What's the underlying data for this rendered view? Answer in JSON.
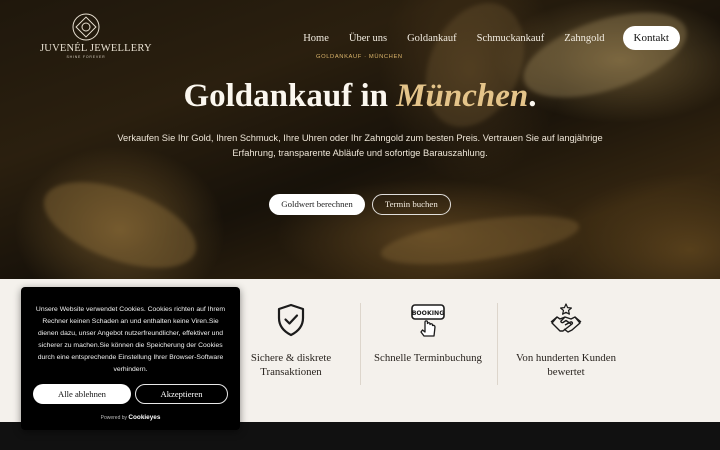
{
  "brand": {
    "name": "JUVENÉL JEWELLERY",
    "tagline": "SHINE FOREVER"
  },
  "nav": {
    "items": [
      "Home",
      "Über uns",
      "Goldankauf",
      "Schmuckankauf",
      "Zahngold"
    ],
    "contact": "Kontakt"
  },
  "hero": {
    "breadcrumb": "GOLDANKAUF · MÜNCHEN",
    "title_main": "Goldankauf in ",
    "title_accent": "München",
    "title_end": ".",
    "lead": "Verkaufen Sie Ihr Gold, Ihren Schmuck, Ihre Uhren oder Ihr Zahngold zum besten Preis. Vertrauen Sie auf langjährige Erfahrung, transparente Abläufe und sofortige Barauszahlung.",
    "primary_button": "Goldwert berechnen",
    "secondary_button": "Termin buchen"
  },
  "features": [
    {
      "label": "Sichere & diskrete Transaktionen",
      "icon": "shield-check-icon"
    },
    {
      "label": "Schnelle Terminbuchung",
      "icon": "booking-icon",
      "icon_text": "BOOKING"
    },
    {
      "label": "Von hunderten Kunden bewertet",
      "icon": "handshake-star-icon"
    }
  ],
  "cookie": {
    "text": "Unsere Website verwendet Cookies. Cookies richten auf Ihrem Rechner keinen Schaden an und enthalten keine Viren.Sie dienen dazu, unser Angebot nutzerfreundlicher, effektiver und sicherer zu machen.Sie können die Speicherung der Cookies durch eine entsprechende Einstellung Ihrer Browser-Software verhindern.",
    "reject": "Alle ablehnen",
    "accept": "Akzeptieren",
    "powered_by": "Powered by",
    "provider": "Cookieyes"
  },
  "colors": {
    "accent_gold": "#e4c48a",
    "breadcrumb_gold": "#d9b36a",
    "section_bg": "#f4f1ec"
  }
}
